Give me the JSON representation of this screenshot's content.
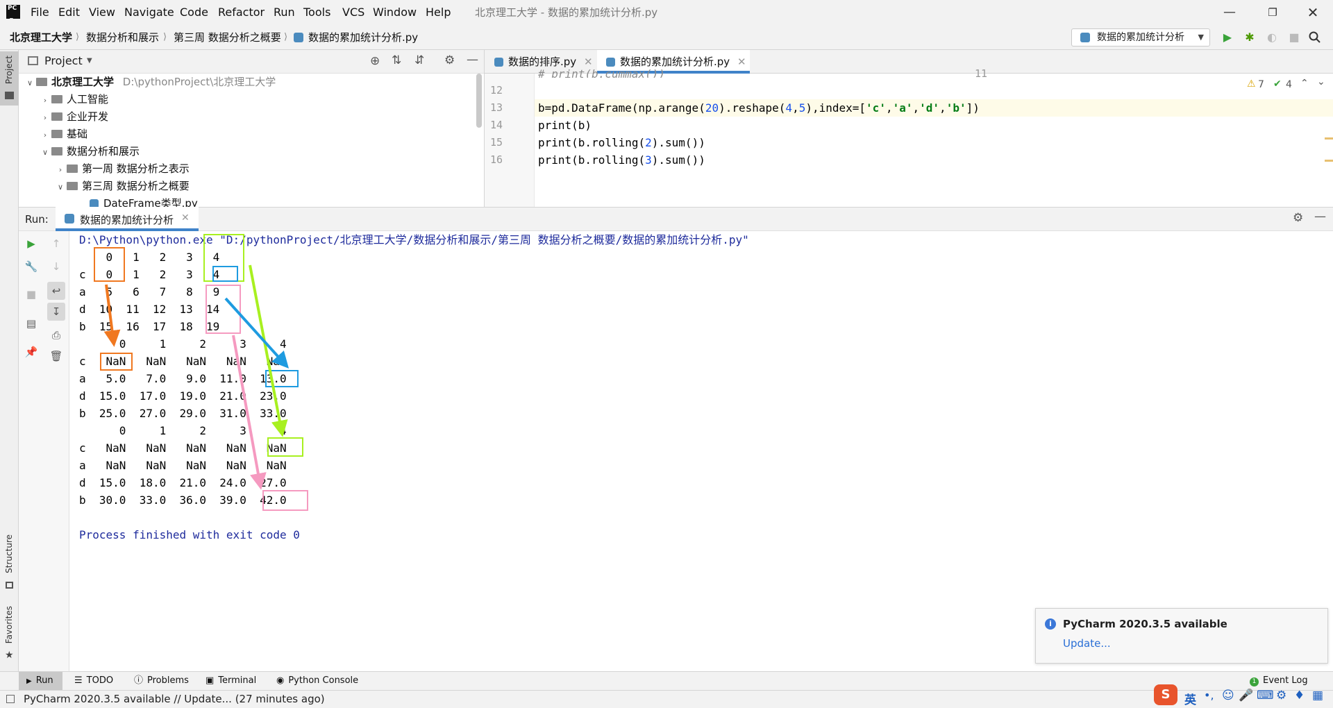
{
  "menu": [
    "File",
    "Edit",
    "View",
    "Navigate",
    "Code",
    "Refactor",
    "Run",
    "Tools",
    "VCS",
    "Window",
    "Help"
  ],
  "window_title": "北京理工大学 - 数据的累加统计分析.py",
  "breadcrumb": [
    "北京理工大学",
    "数据分析和展示",
    "第三周 数据分析之概要",
    "数据的累加统计分析.py"
  ],
  "run_config": "数据的累加统计分析",
  "project": {
    "header": "Project",
    "root_name": "北京理工大学",
    "root_path": "D:\\pythonProject\\北京理工大学",
    "items": [
      {
        "label": "人工智能"
      },
      {
        "label": "企业开发"
      },
      {
        "label": "基础"
      },
      {
        "label": "数据分析和展示"
      },
      {
        "label": "第一周 数据分析之表示"
      },
      {
        "label": "第三周 数据分析之概要"
      },
      {
        "label": "DateFrame类型.py"
      }
    ]
  },
  "editor": {
    "tabs": [
      "数据的排序.py",
      "数据的累加统计分析.py"
    ],
    "warnings": "7",
    "checks": "4",
    "line_numbers": [
      "11",
      "12",
      "13",
      "14",
      "15",
      "16"
    ],
    "lines": {
      "l11": "# print(b.cummax())",
      "l13": {
        "a": "b=pd.DataFrame(np.arange(",
        "n1": "20",
        "b": ").reshape(",
        "n2": "4",
        "c": ",",
        "n3": "5",
        "d": "),index=[",
        "s1": "'c'",
        "e": ",",
        "s2": "'a'",
        "f": ",",
        "s3": "'d'",
        "g": ",",
        "s4": "'b'",
        "h": "])"
      },
      "l14": "print(b)",
      "l15": {
        "a": "print(b.rolling(",
        "n": "2",
        "b": ").sum())"
      },
      "l16": {
        "a": "print(b.rolling(",
        "n": "3",
        "b": ").sum())"
      }
    }
  },
  "run": {
    "label": "Run:",
    "tab": "数据的累加统计分析",
    "console": [
      "D:\\Python\\python.exe \"D:/pythonProject/北京理工大学/数据分析和展示/第三周 数据分析之概要/数据的累加统计分析.py\"",
      "    0   1   2   3   4",
      "c   0   1   2   3   4",
      "a   5   6   7   8   9",
      "d  10  11  12  13  14",
      "b  15  16  17  18  19",
      "      0     1     2     3     4",
      "c   NaN   NaN   NaN   NaN   NaN",
      "a   5.0   7.0   9.0  11.0  13.0",
      "d  15.0  17.0  19.0  21.0  23.0",
      "b  25.0  27.0  29.0  31.0  33.0",
      "      0     1     2     3     4",
      "c   NaN   NaN   NaN   NaN   NaN",
      "a   NaN   NaN   NaN   NaN   NaN",
      "d  15.0  18.0  21.0  24.0  27.0",
      "b  30.0  33.0  36.0  39.0  42.0",
      "",
      "Process finished with exit code 0"
    ]
  },
  "annotation_colors": {
    "orange": "#f07820",
    "green": "#a8f020",
    "blue": "#1e9be0",
    "pink": "#f59ac0"
  },
  "left_strip": {
    "project": "Project",
    "structure": "Structure",
    "favorites": "Favorites"
  },
  "bottom_tools": [
    "Run",
    "TODO",
    "Problems",
    "Terminal",
    "Python Console"
  ],
  "event_log": "Event Log",
  "status": "PyCharm 2020.3.5 available // Update... (27 minutes ago)",
  "notification": {
    "title": "PyCharm 2020.3.5 available",
    "link": "Update..."
  },
  "ime": "英"
}
